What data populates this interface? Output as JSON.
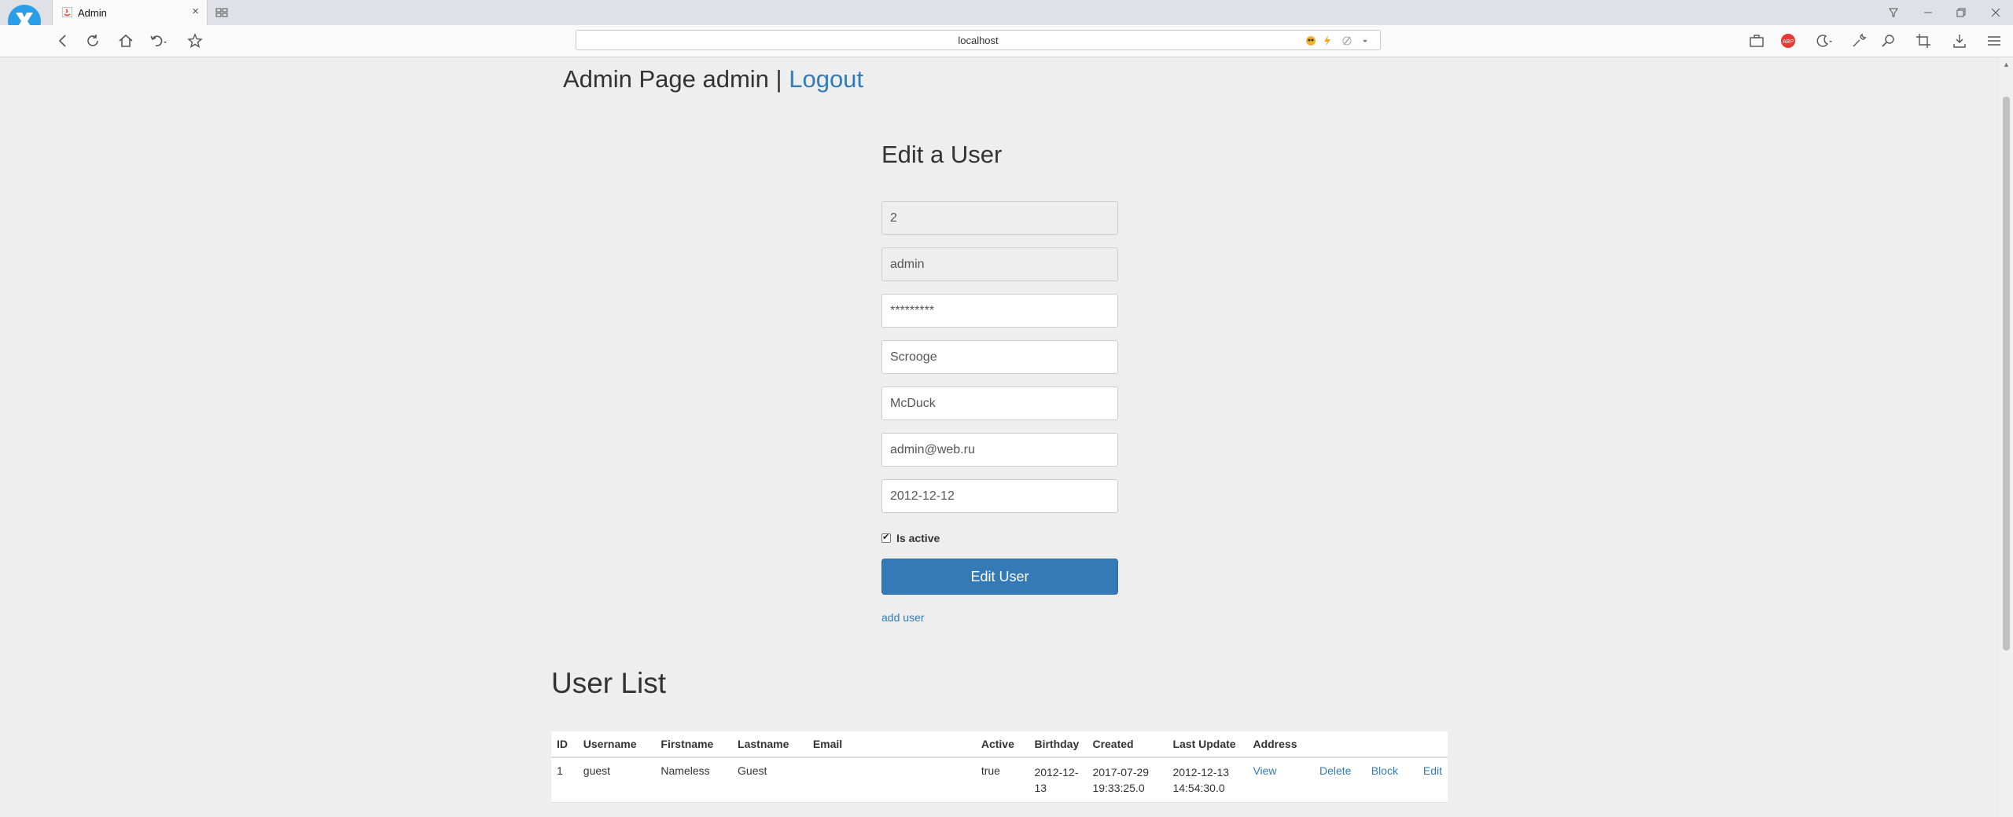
{
  "browser": {
    "tab_title": "Admin",
    "tab_close": "×",
    "address": "localhost"
  },
  "header": {
    "text": "Admin Page admin |",
    "logout_label": "Logout"
  },
  "form": {
    "title": "Edit a User",
    "fields": {
      "id": "2",
      "username": "admin",
      "password": "*********",
      "firstname": "Scrooge",
      "lastname": "McDuck",
      "email": "admin@web.ru",
      "birthday": "2012-12-12"
    },
    "is_active_label": "Is active",
    "is_active": true,
    "submit_label": "Edit User",
    "add_user_label": "add user"
  },
  "user_list": {
    "title": "User List",
    "columns": [
      "ID",
      "Username",
      "Firstname",
      "Lastname",
      "Email",
      "Active",
      "Birthday",
      "Created",
      "Last Update",
      "Address"
    ],
    "rows": [
      {
        "id": "1",
        "username": "guest",
        "firstname": "Nameless",
        "lastname": "Guest",
        "email": "",
        "active": "true",
        "birthday": "2012-12-13",
        "created": "2017-07-29 19:33:25.0",
        "last_update": "2012-12-13 14:54:30.0",
        "actions": {
          "view": "View",
          "delete": "Delete",
          "block": "Block",
          "edit": "Edit"
        }
      }
    ]
  },
  "colors": {
    "link": "#337ab7",
    "button": "#337ab7",
    "page_bg": "#eeeeee"
  }
}
